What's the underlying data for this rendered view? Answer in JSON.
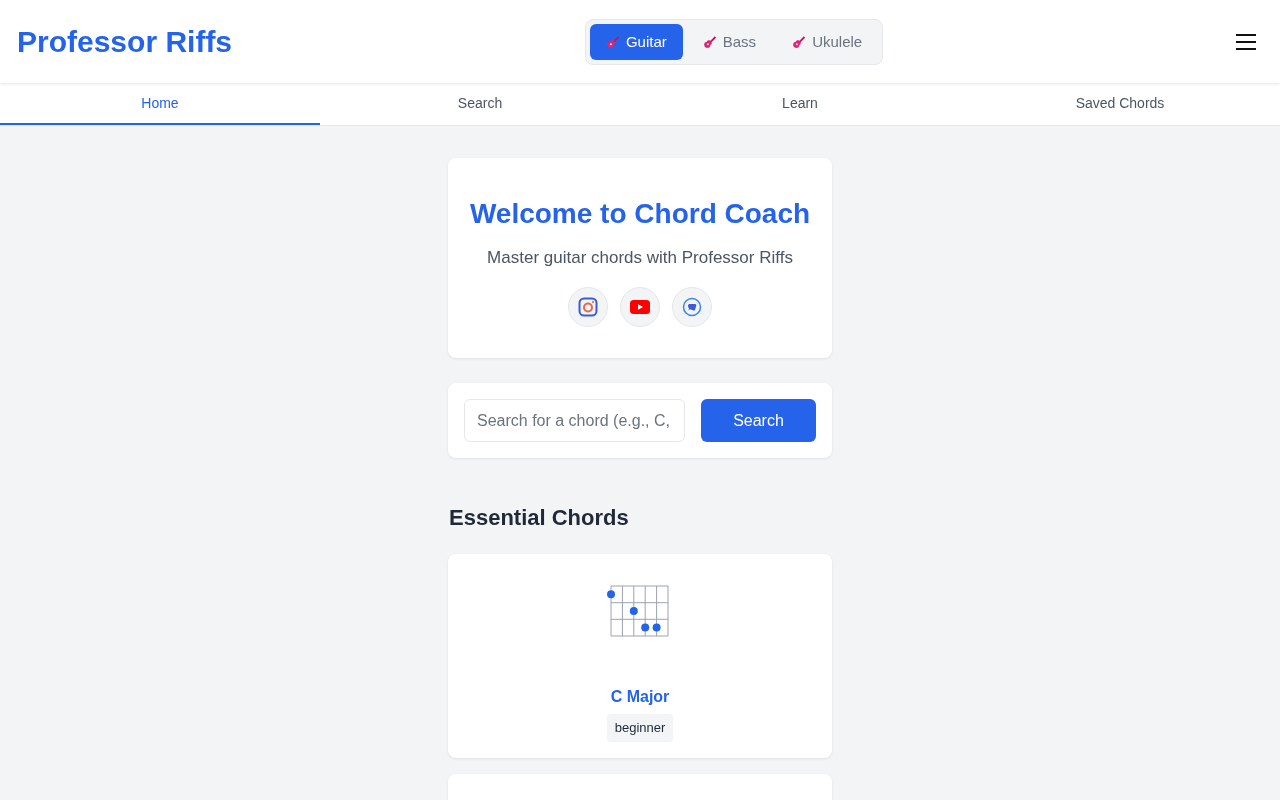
{
  "header": {
    "title": "Professor Riffs",
    "instruments": [
      {
        "label": "Guitar",
        "selected": true
      },
      {
        "label": "Bass",
        "selected": false
      },
      {
        "label": "Ukulele",
        "selected": false
      }
    ]
  },
  "nav": {
    "tabs": [
      {
        "label": "Home",
        "selected": true
      },
      {
        "label": "Search",
        "selected": false
      },
      {
        "label": "Learn",
        "selected": false
      },
      {
        "label": "Saved Chords",
        "selected": false
      }
    ]
  },
  "welcome": {
    "title": "Welcome to Chord Coach",
    "subtitle": "Master guitar chords with Professor Riffs"
  },
  "search": {
    "placeholder": "Search for a chord (e.g., C,",
    "button": "Search"
  },
  "essential_chords": {
    "title": "Essential Chords",
    "chords": [
      {
        "name": "C Major",
        "difficulty": "beginner"
      }
    ]
  }
}
